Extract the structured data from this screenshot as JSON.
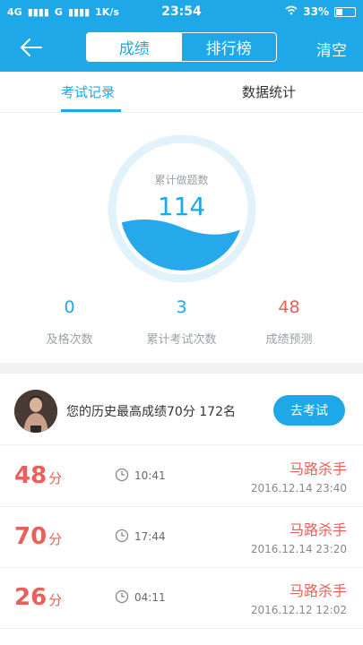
{
  "statusbar": {
    "network": "4G",
    "carrier": "G",
    "speed": "1K/s",
    "time": "23:54",
    "battery": "33%"
  },
  "header": {
    "tabs": [
      "成绩",
      "排行榜"
    ],
    "clear_label": "清空"
  },
  "subtabs": [
    "考试记录",
    "数据统计"
  ],
  "gauge": {
    "label": "累计做题数",
    "value": "114"
  },
  "stats": [
    {
      "value": "0",
      "label": "及格次数",
      "color": "#1ea8e8"
    },
    {
      "value": "3",
      "label": "累计考试次数",
      "color": "#1ea8e8"
    },
    {
      "value": "48",
      "label": "成绩预测",
      "color": "#e8605a"
    }
  ],
  "best": {
    "text": "您的历史最高成绩70分  172名",
    "button": "去考试"
  },
  "records": [
    {
      "score": "48",
      "unit": "分",
      "duration": "10:41",
      "title": "马路杀手",
      "date": "2016.12.14  23:40"
    },
    {
      "score": "70",
      "unit": "分",
      "duration": "17:44",
      "title": "马路杀手",
      "date": "2016.12.14  23:20"
    },
    {
      "score": "26",
      "unit": "分",
      "duration": "04:11",
      "title": "马路杀手",
      "date": "2016.12.12  12:02"
    }
  ]
}
